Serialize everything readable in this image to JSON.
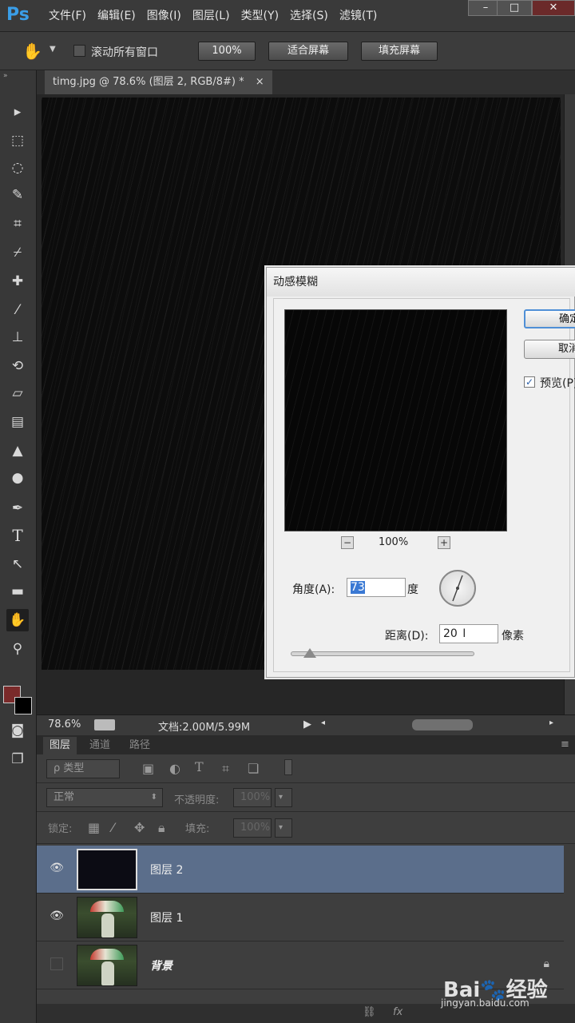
{
  "app": {
    "logo": "Ps"
  },
  "menu": [
    "文件(F)",
    "编辑(E)",
    "图像(I)",
    "图层(L)",
    "类型(Y)",
    "选择(S)",
    "滤镜(T)"
  ],
  "window_controls": {
    "minimize": "–",
    "maximize": "□",
    "close": "✕"
  },
  "options_bar": {
    "scroll_all_label": "滚动所有窗口",
    "zoom_100": "100%",
    "fit_screen": "适合屏幕",
    "fill_screen": "填充屏幕"
  },
  "document": {
    "tab_title": "timg.jpg @ 78.6% (图层 2, RGB/8#) *",
    "close": "×"
  },
  "status": {
    "zoom": "78.6%",
    "doc_size": "文档:2.00M/5.99M"
  },
  "panel_tabs": [
    "图层",
    "通道",
    "路径"
  ],
  "layers_panel": {
    "filter_label": "ρ 类型",
    "blend_mode": "正常",
    "opacity_label": "不透明度:",
    "opacity_value": "100%",
    "lock_label": "锁定:",
    "fill_label": "填充:",
    "fill_value": "100%",
    "layers": [
      {
        "name": "图层 2",
        "visible": true,
        "selected": true
      },
      {
        "name": "图层 1",
        "visible": true,
        "selected": false
      },
      {
        "name": "背景",
        "visible": false,
        "selected": false,
        "locked": true
      }
    ]
  },
  "dialog": {
    "title": "动感模糊",
    "ok_label": "确定",
    "cancel_label": "取消",
    "preview_label": "预览(P)",
    "preview_checked": true,
    "zoom_level": "100%",
    "zoom_out": "−",
    "zoom_in": "+",
    "angle_label": "角度(A):",
    "angle_value": "73",
    "angle_unit": "度",
    "distance_label": "距离(D):",
    "distance_value": "20",
    "distance_unit": "像素"
  },
  "watermark": {
    "brand": "Bai🐾经验",
    "url": "jingyan.baidu.com"
  }
}
